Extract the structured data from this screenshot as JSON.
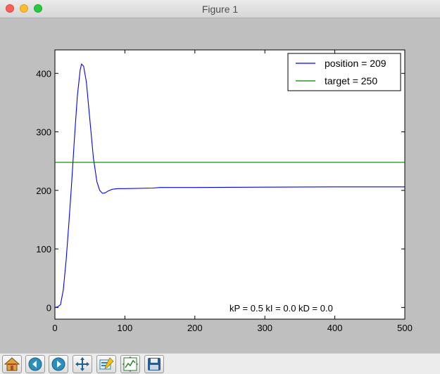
{
  "window": {
    "title": "Figure 1"
  },
  "toolbar": {
    "buttons": [
      {
        "name": "home-button",
        "icon": "home-icon"
      },
      {
        "name": "back-button",
        "icon": "arrow-left-icon"
      },
      {
        "name": "forward-button",
        "icon": "arrow-right-icon"
      },
      {
        "name": "pan-button",
        "icon": "move-icon"
      },
      {
        "name": "zoom-button",
        "icon": "zoom-rect-icon"
      },
      {
        "name": "subplots-button",
        "icon": "subplots-icon"
      },
      {
        "name": "save-button",
        "icon": "save-icon"
      }
    ]
  },
  "chart_data": {
    "type": "line",
    "xlim": [
      0,
      500
    ],
    "ylim": [
      -20,
      440
    ],
    "x_ticks": [
      0,
      100,
      200,
      300,
      400,
      500
    ],
    "y_ticks": [
      0,
      100,
      200,
      300,
      400
    ],
    "x_tick_labels": [
      "0",
      "100",
      "200",
      "300",
      "400",
      "500"
    ],
    "y_tick_labels": [
      "0",
      "100",
      "200",
      "300",
      "400"
    ],
    "annotation": "kP = 0.5 kI = 0.0 kD = 0.0",
    "legend_placement": "top-right",
    "series": [
      {
        "name": "position = 209",
        "color": "#0000ff",
        "points": [
          [
            0,
            0
          ],
          [
            4,
            1
          ],
          [
            8,
            5
          ],
          [
            12,
            30
          ],
          [
            16,
            80
          ],
          [
            20,
            145
          ],
          [
            24,
            215
          ],
          [
            28,
            290
          ],
          [
            32,
            360
          ],
          [
            36,
            405
          ],
          [
            38,
            416
          ],
          [
            41,
            412
          ],
          [
            45,
            385
          ],
          [
            50,
            320
          ],
          [
            55,
            255
          ],
          [
            60,
            215
          ],
          [
            64,
            200
          ],
          [
            68,
            195
          ],
          [
            72,
            196
          ],
          [
            76,
            199
          ],
          [
            82,
            202
          ],
          [
            90,
            203
          ],
          [
            100,
            203
          ],
          [
            140,
            204
          ],
          [
            150,
            205
          ],
          [
            200,
            205
          ],
          [
            300,
            205.5
          ],
          [
            400,
            206
          ],
          [
            500,
            206
          ]
        ]
      },
      {
        "name": "target = 250",
        "color": "#008000",
        "points": [
          [
            0,
            248
          ],
          [
            500,
            248
          ]
        ]
      }
    ]
  }
}
